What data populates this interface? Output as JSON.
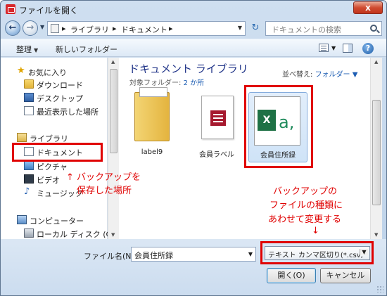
{
  "window": {
    "title": "ファイルを開く",
    "close_label": "x"
  },
  "address": {
    "segments": [
      "▸",
      "ライブラリ",
      "▸",
      "ドキュメント",
      "▸"
    ],
    "search_placeholder": "ドキュメントの検索"
  },
  "toolbar": {
    "organize": "整理",
    "new_folder": "新しいフォルダー",
    "help": "?"
  },
  "sidebar": {
    "items": [
      {
        "label": "お気に入り",
        "icon": "star-icon"
      },
      {
        "label": "ダウンロード",
        "icon": "download-folder-icon"
      },
      {
        "label": "デスクトップ",
        "icon": "desktop-icon"
      },
      {
        "label": "最近表示した場所",
        "icon": "recent-places-icon"
      },
      {
        "label": "ライブラリ",
        "icon": "library-icon"
      },
      {
        "label": "ドキュメント",
        "icon": "documents-icon"
      },
      {
        "label": "ピクチャ",
        "icon": "pictures-icon"
      },
      {
        "label": "ビデオ",
        "icon": "videos-icon"
      },
      {
        "label": "ミュージック",
        "icon": "music-icon"
      },
      {
        "label": "コンピューター",
        "icon": "computer-icon"
      },
      {
        "label": "ローカル ディスク (C:)",
        "icon": "local-disk-icon"
      }
    ]
  },
  "main": {
    "library_title": "ドキュメント ライブラリ",
    "subtitle_prefix": "対象フォルダー: ",
    "subtitle_link": "2 か所",
    "sort_label": "並べ替え:",
    "sort_value": "フォルダー",
    "files": [
      {
        "name": "label9",
        "icon": "folder-icon"
      },
      {
        "name": "会員ラベル",
        "icon": "database-file-icon"
      },
      {
        "name": "会員住所録",
        "icon": "csv-excel-icon"
      }
    ]
  },
  "annotations": {
    "backup_line1": "↑ バックアップを",
    "backup_line2": "保存した場所",
    "type_line1": "バックアップの",
    "type_line2": "ファイルの種類に",
    "type_line3": "あわせて変更する",
    "type_arrow": "↓"
  },
  "footer": {
    "filename_label": "ファイル名(N):",
    "filename_value": "会員住所録",
    "filetype_value": "テキスト カンマ区切り(*.csv;",
    "open_label": "開く(O)",
    "cancel_label": "キャンセル"
  },
  "colors": {
    "annotation_red": "#e00000",
    "title_blue": "#1e3287",
    "excel_green": "#1e7145"
  }
}
